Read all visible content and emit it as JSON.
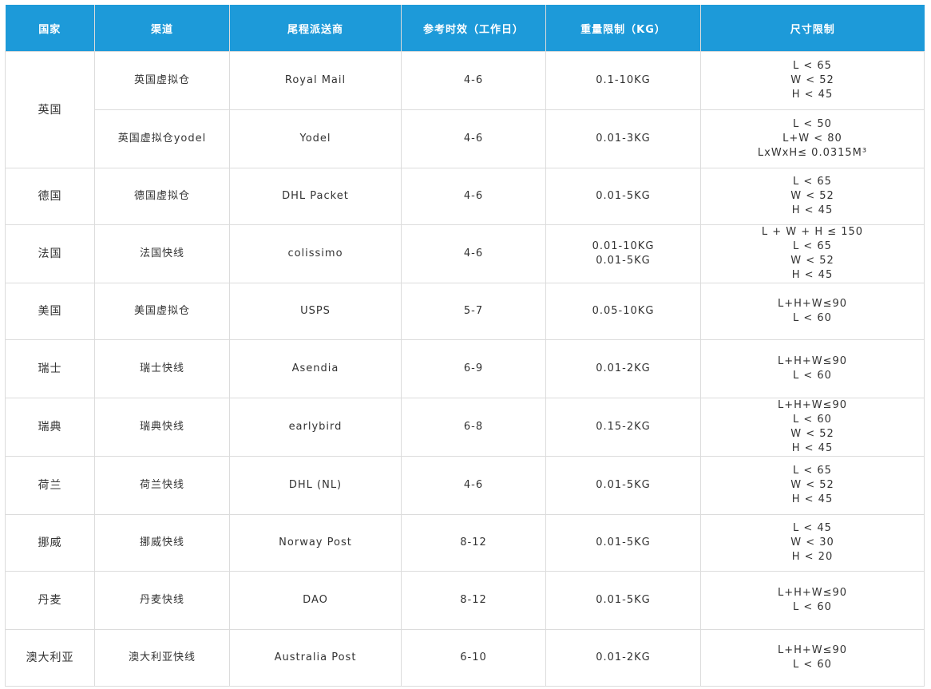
{
  "header": [
    "国家",
    "渠道",
    "尾程派送商",
    "参考时效（工作日）",
    "重量限制（KG）",
    "尺寸限制"
  ],
  "rows": [
    {
      "country": "英国",
      "rowspan": 2,
      "channel": "英国虚拟仓",
      "carrier": "Royal Mail",
      "days": "4-6",
      "weight": [
        "0.1-10KG"
      ],
      "size": [
        "L < 65",
        "W < 52",
        "H < 45"
      ]
    },
    {
      "channel": "英国虚拟仓yodel",
      "carrier": "Yodel",
      "days": "4-6",
      "weight": [
        "0.01-3KG"
      ],
      "size": [
        "L < 50",
        "L+W < 80",
        "LxWxH≤ 0.0315M³"
      ]
    },
    {
      "country": "德国",
      "channel": "德国虚拟仓",
      "carrier": "DHL Packet",
      "days": "4-6",
      "weight": [
        "0.01-5KG"
      ],
      "size": [
        "L < 65",
        "W < 52",
        "H < 45"
      ]
    },
    {
      "country": "法国",
      "channel": "法国快线",
      "carrier": "colissimo",
      "days": "4-6",
      "weight": [
        "0.01-10KG",
        "0.01-5KG"
      ],
      "size": [
        "L + W + H ≤ 150",
        "L < 65",
        "W < 52",
        "H < 45"
      ]
    },
    {
      "country": "美国",
      "channel": "美国虚拟仓",
      "carrier": "USPS",
      "days": "5-7",
      "weight": [
        "0.05-10KG"
      ],
      "size": [
        "L+H+W≤90",
        "L < 60"
      ]
    },
    {
      "country": "瑞士",
      "channel": "瑞士快线",
      "carrier": "Asendia",
      "days": "6-9",
      "weight": [
        "0.01-2KG"
      ],
      "size": [
        "L+H+W≤90",
        "L < 60"
      ]
    },
    {
      "country": "瑞典",
      "channel": "瑞典快线",
      "carrier": "earlybird",
      "days": "6-8",
      "weight": [
        "0.15-2KG"
      ],
      "size": [
        "L+H+W≤90",
        "L < 60",
        "W < 52",
        "H < 45"
      ]
    },
    {
      "country": "荷兰",
      "channel": "荷兰快线",
      "carrier": "DHL (NL)",
      "days": "4-6",
      "weight": [
        "0.01-5KG"
      ],
      "size": [
        "L < 65",
        "W < 52",
        "H < 45"
      ]
    },
    {
      "country": "挪威",
      "channel": "挪威快线",
      "carrier": "Norway Post",
      "days": "8-12",
      "weight": [
        "0.01-5KG"
      ],
      "size": [
        "L < 45",
        "W < 30",
        "H < 20"
      ]
    },
    {
      "country": "丹麦",
      "channel": "丹麦快线",
      "carrier": "DAO",
      "days": "8-12",
      "weight": [
        "0.01-5KG"
      ],
      "size": [
        "L+H+W≤90",
        "L < 60"
      ]
    },
    {
      "country": "澳大利亚",
      "channel": "澳大利亚快线",
      "carrier": "Australia Post",
      "days": "6-10",
      "weight": [
        "0.01-2KG"
      ],
      "size": [
        "L+H+W≤90",
        "L < 60"
      ]
    }
  ]
}
